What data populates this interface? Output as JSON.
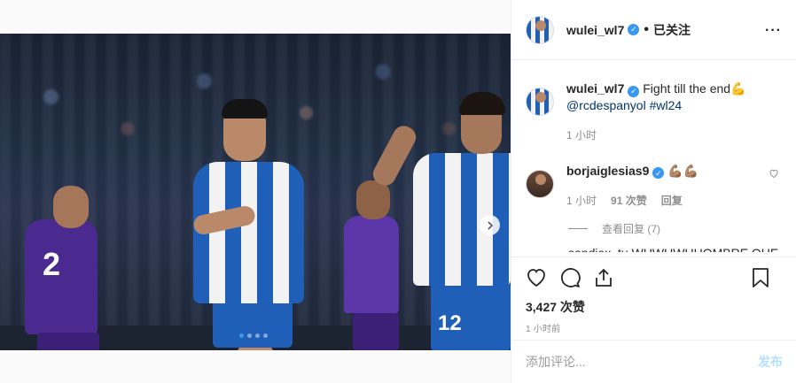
{
  "header": {
    "username": "wulei_wl7",
    "separator": "•",
    "follow_status": "已关注",
    "more": "···"
  },
  "caption": {
    "username": "wulei_wl7",
    "text": "Fight till the end💪",
    "mention": "@rcdespanyol",
    "hashtag": "#wl24",
    "time": "1 小时"
  },
  "comment": {
    "username": "borjaiglesias9",
    "text": "💪🏽💪🏽",
    "time": "1 小时",
    "likes": "91 次赞",
    "reply": "回复",
    "view_replies": "查看回复 (7)"
  },
  "partial_comment": "sandiax_tu  WUWUWUHOMBRE QUE",
  "photo": {
    "jersey_number_right": "12",
    "jersey_number_left": "2",
    "carousel_dots": 4,
    "active_dot": 1
  },
  "actions": {
    "likes": "3,427 次赞",
    "time": "1 小时前"
  },
  "add_comment": {
    "placeholder": "添加评论...",
    "post_label": "发布"
  },
  "colors": {
    "accent": "#3897f0",
    "post_disabled": "#b2dffc",
    "secondary_text": "#8e8e8e"
  }
}
